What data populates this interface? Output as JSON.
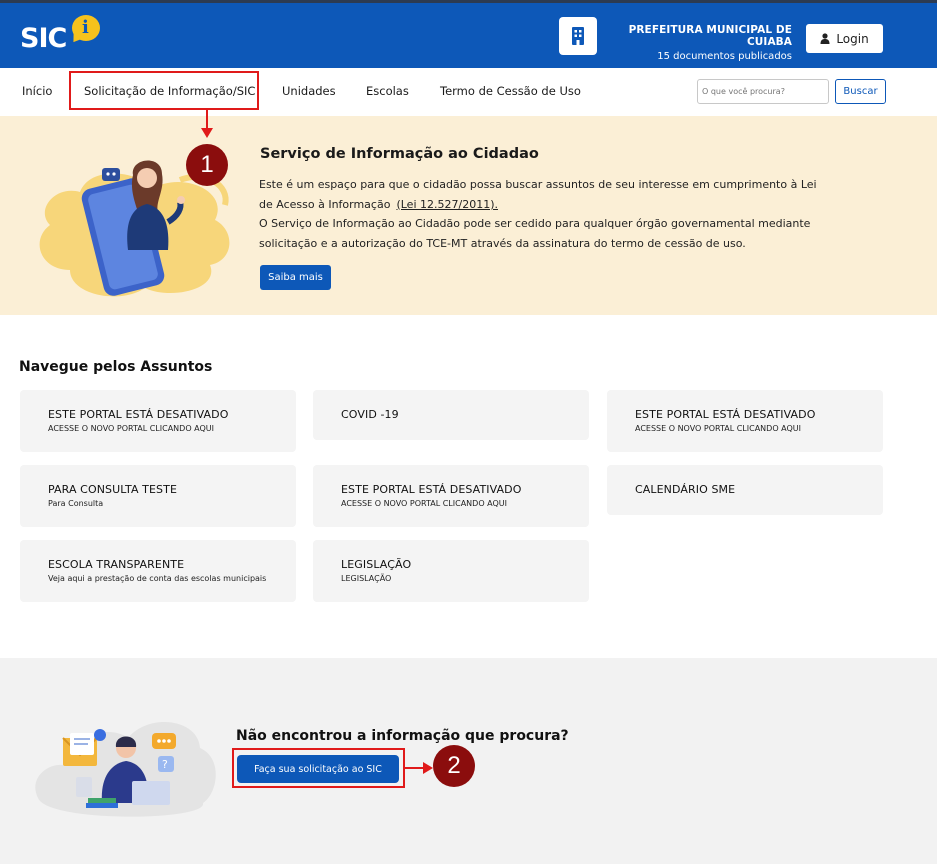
{
  "header": {
    "logo_text": "SIC",
    "logo_badge": "i",
    "org_name": "PREFEITURA MUNICIPAL DE CUIABA",
    "docs_count": "15 documentos publicados",
    "login_label": "Login",
    "icons": {
      "building": "building-icon",
      "user": "user-icon"
    },
    "brand_color": "#0d58b8"
  },
  "nav": {
    "items": [
      {
        "label": "Início"
      },
      {
        "label": "Solicitação de Informação/SIC"
      },
      {
        "label": "Unidades"
      },
      {
        "label": "Escolas"
      },
      {
        "label": "Termo de Cessão de Uso"
      }
    ],
    "search_placeholder": "O que você procura?",
    "search_button": "Buscar"
  },
  "hero": {
    "title": "Serviço de Informação ao Cidadao",
    "text_1": "Este é um espaço para que o cidadão possa buscar assuntos de seu interesse em cumprimento à Lei de Acesso à Informação",
    "law_link": "(Lei 12.527/2011).",
    "text_2": "O Serviço de Informação ao Cidadão pode ser cedido para qualquer órgão governamental mediante solicitação e a autorização do TCE-MT através da assinatura do termo de cessão de uso.",
    "button": "Saiba mais"
  },
  "topics": {
    "title": "Navegue pelos Assuntos",
    "cards": [
      {
        "title": "ESTE PORTAL ESTÁ DESATIVADO",
        "subtitle": "ACESSE O NOVO PORTAL CLICANDO AQUI"
      },
      {
        "title": "COVID -19",
        "subtitle": ""
      },
      {
        "title": "ESTE PORTAL ESTÁ DESATIVADO",
        "subtitle": "ACESSE O NOVO PORTAL CLICANDO AQUI"
      },
      {
        "title": "PARA CONSULTA TESTE",
        "subtitle": "Para Consulta"
      },
      {
        "title": "ESTE PORTAL ESTÁ DESATIVADO",
        "subtitle": "ACESSE O NOVO PORTAL CLICANDO AQUI"
      },
      {
        "title": "CALENDÁRIO SME",
        "subtitle": ""
      },
      {
        "title": "ESCOLA TRANSPARENTE",
        "subtitle": "Veja aqui a prestação de conta das escolas municipais"
      },
      {
        "title": "LEGISLAÇÃO",
        "subtitle": "LEGISLAÇÃO"
      }
    ]
  },
  "bottom": {
    "title": "Não encontrou a informação que procura?",
    "button": "Faça sua solicitação ao SIC"
  },
  "annotations": {
    "marker_1": "1",
    "marker_2": "2",
    "annotation_color": "#e01a1a",
    "marker_color": "#8b0d0d"
  }
}
